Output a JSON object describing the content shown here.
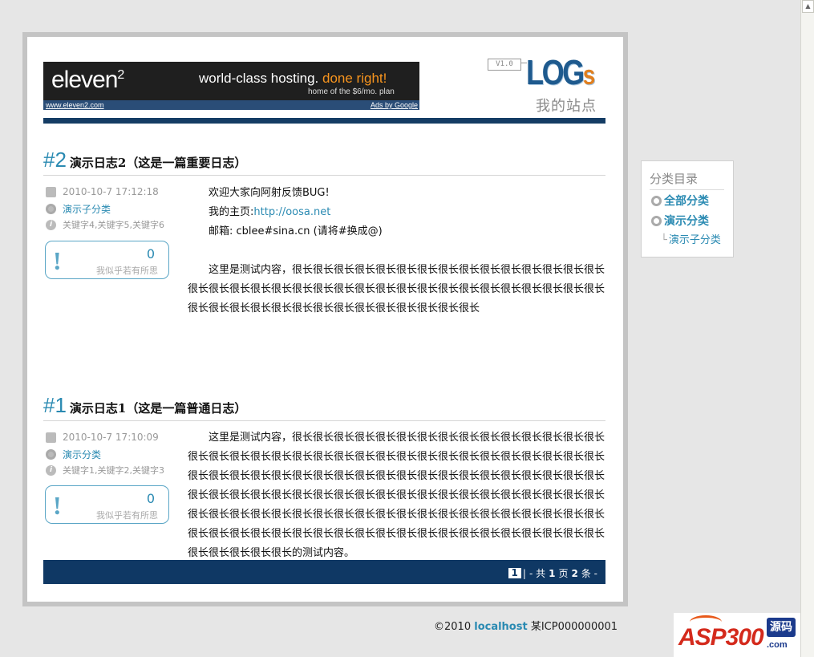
{
  "ad": {
    "logo": "eleven",
    "logo_sup": "2",
    "tagline_a": "world-class hosting.",
    "tagline_b": "done right!",
    "subline": "home of the $6/mo. plan",
    "url": "www.eleven2.com",
    "ads_by": "Ads by Google"
  },
  "header": {
    "version": "V1.0",
    "logo_main": "LOG",
    "logo_s": "s",
    "site_name": "我的站点"
  },
  "posts": [
    {
      "num": "#2",
      "title": "演示日志2（这是一篇重要日志）",
      "date": "2010-10-7 17:12:18",
      "category": "演示子分类",
      "keywords": "关键字4,关键字5,关键字6",
      "comments": "0",
      "comment_hint": "我似乎若有所思",
      "lines": {
        "l1": "欢迎大家向阿射反馈BUG!",
        "l2_label": "我的主页:",
        "l2_link": "http://oosa.net",
        "l3": "邮箱: cblee#sina.cn (请将#换成@)",
        "body": "这里是测试内容，很长很长很长很长很长很长很长很长很长很长很长很长很长很长很长很长很长很长很长很长很长很长很长很长很长很长很长很长很长很长很长很长很长很长很长很长很长很长很长很长很长很长很长很长很长很长很长很长很长"
      }
    },
    {
      "num": "#1",
      "title": "演示日志1（这是一篇普通日志）",
      "date": "2010-10-7 17:10:09",
      "category": "演示分类",
      "keywords": "关键字1,关键字2,关键字3",
      "comments": "0",
      "comment_hint": "我似乎若有所思",
      "lines": {
        "body": "这里是测试内容，很长很长很长很长很长很长很长很长很长很长很长很长很长很长很长很长很长很长很长很长很长很长很长很长很长很长很长很长很长很长很长很长很长很长很长很长很长很长很长很长很长很长很长很长很长很长很长很长很长很长很长很长很长很长很长很长很长很长很长很长很长很长很长很长很长很长很长很长很长很长很长很长很长很长很长很长很长很长很长很长很长很长很长很长很长很长很长很长很长很长很长很长很长很长很长很长很长很长很长很长很长很长很长很长很长很长很长很长很长很长很长很长很长很长很长很长很长很长很长很长的测试内容。"
      }
    }
  ],
  "pager": {
    "current": "1",
    "sep": "|",
    "total_label": "- 共",
    "total_pages": "1",
    "page_unit": "页",
    "total_items": "2",
    "item_unit": "条 -"
  },
  "sidebar": {
    "title": "分类目录",
    "all": "全部分类",
    "demo": "演示分类",
    "tree": "└",
    "sub": "演示子分类"
  },
  "footer": {
    "copyright": "©2010",
    "host": "localhost",
    "icp": "某ICP000000001"
  },
  "watermark": {
    "text": "ASP300",
    "badge": "源码",
    "dot": ".com"
  }
}
